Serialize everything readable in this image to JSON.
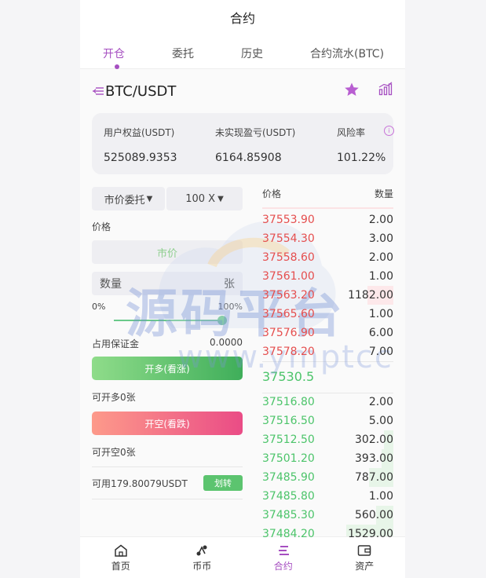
{
  "header": {
    "title": "合约"
  },
  "tabs": [
    {
      "label": "开仓",
      "active": true
    },
    {
      "label": "委托"
    },
    {
      "label": "历史"
    },
    {
      "label": "合约流水(BTC)"
    }
  ],
  "symbol": {
    "name": "BTC/USDT"
  },
  "summary": {
    "equity_label": "用户权益(USDT)",
    "equity_value": "525089.9353",
    "pnl_label": "未实现盈亏(USDT)",
    "pnl_value": "6164.85908",
    "risk_label": "风险率",
    "risk_value": "101.22%"
  },
  "order_form": {
    "order_type": "市价委托",
    "leverage": "100 X",
    "price_label": "价格",
    "price_value": "市价",
    "qty_placeholder": "数量",
    "qty_unit": "张",
    "slider_min": "0%",
    "slider_max": "100%",
    "slider_level": 1.0,
    "margin_label": "占用保证金",
    "margin_value": "0.0000",
    "open_long_label": "开多(看涨)",
    "long_available": "可开多0张",
    "open_short_label": "开空(看跌)",
    "short_available": "可开空0张",
    "available": "可用179.80079USDT",
    "transfer_label": "划转"
  },
  "orderbook": {
    "price_header": "价格",
    "qty_header": "数量",
    "last_price": "37530.5",
    "asks": [
      {
        "price": "37553.90",
        "qty": "2.00",
        "depth": 0.0
      },
      {
        "price": "37554.30",
        "qty": "3.00",
        "depth": 0.0
      },
      {
        "price": "37558.60",
        "qty": "2.00",
        "depth": 0.0
      },
      {
        "price": "37561.00",
        "qty": "1.00",
        "depth": 0.0
      },
      {
        "price": "37563.20",
        "qty": "1182.00",
        "depth": 0.55
      },
      {
        "price": "37565.60",
        "qty": "1.00",
        "depth": 0.0
      },
      {
        "price": "37576.90",
        "qty": "6.00",
        "depth": 0.0
      },
      {
        "price": "37578.20",
        "qty": "7.00",
        "depth": 0.0
      }
    ],
    "bids": [
      {
        "price": "37516.80",
        "qty": "2.00",
        "depth": 0.0
      },
      {
        "price": "37516.50",
        "qty": "5.00",
        "depth": 0.0
      },
      {
        "price": "37512.50",
        "qty": "302.00",
        "depth": 0.2
      },
      {
        "price": "37501.20",
        "qty": "393.00",
        "depth": 0.25
      },
      {
        "price": "37485.90",
        "qty": "787.00",
        "depth": 0.51
      },
      {
        "price": "37485.80",
        "qty": "1.00",
        "depth": 0.0
      },
      {
        "price": "37485.30",
        "qty": "560.00",
        "depth": 0.36
      },
      {
        "price": "37484.20",
        "qty": "1529.00",
        "depth": 1.0
      }
    ]
  },
  "watermark": {
    "text": "源码平台",
    "url": "www.ymptcc"
  },
  "nav": [
    {
      "label": "首页",
      "icon": "home-icon"
    },
    {
      "label": "币币",
      "icon": "coin-icon"
    },
    {
      "label": "合约",
      "icon": "contract-icon",
      "active": true
    },
    {
      "label": "资产",
      "icon": "wallet-icon"
    }
  ],
  "colors": {
    "accent": "#a64fc1",
    "up": "#4cc46a",
    "down": "#e54e4e"
  }
}
